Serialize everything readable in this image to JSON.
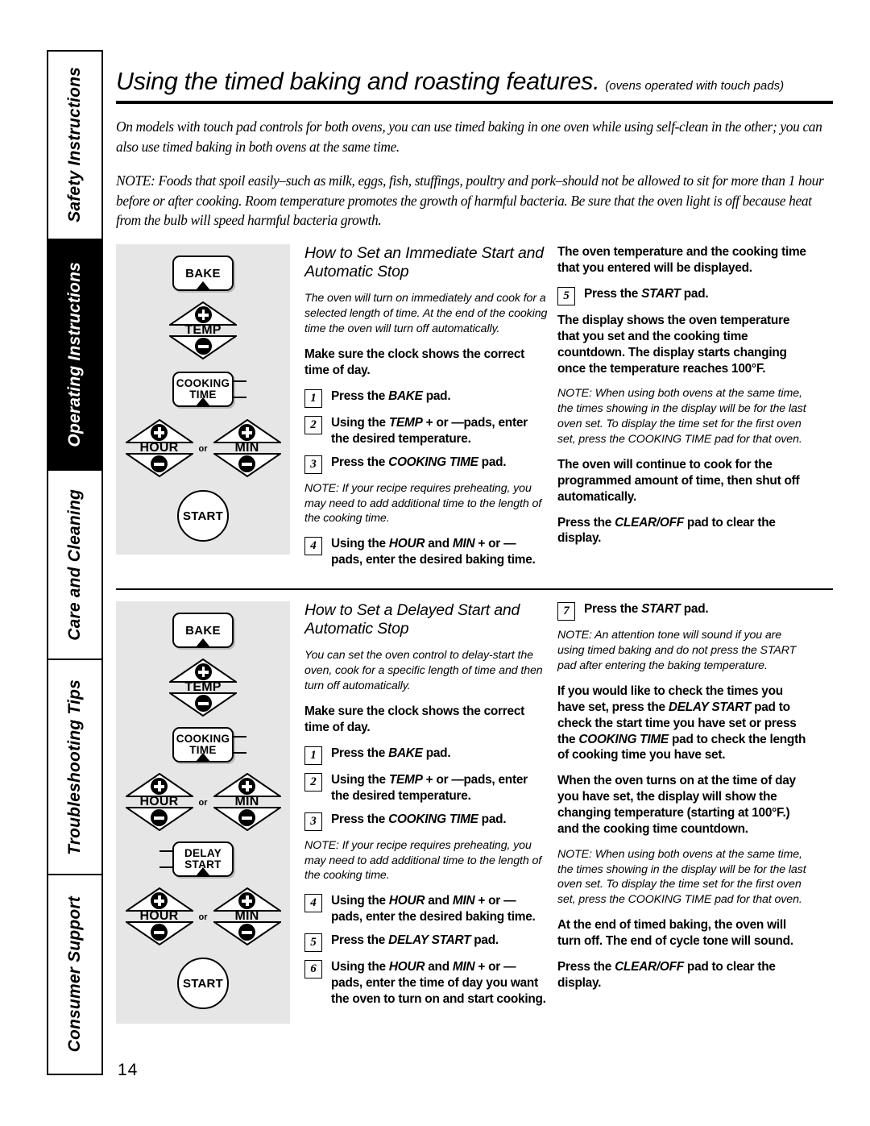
{
  "sidebar": {
    "tabs": [
      {
        "label": "Safety Instructions",
        "active": false
      },
      {
        "label": "Operating Instructions",
        "active": true
      },
      {
        "label": "Care and Cleaning",
        "active": false
      },
      {
        "label": "Troubleshooting Tips",
        "active": false
      },
      {
        "label": "Consumer Support",
        "active": false
      }
    ]
  },
  "header": {
    "title": "Using the timed baking and roasting features.",
    "subtitle": "(ovens operated with touch pads)"
  },
  "intro": {
    "paragraph1": "On models with touch pad controls for both ovens, you can use timed baking in one oven while using self-clean in the other; you can also use timed baking in both ovens at the same time.",
    "paragraph2": "NOTE: Foods that spoil easily–such as milk, eggs, fish, stuffings, poultry and pork–should not be allowed to sit for more than 1 hour before or after cooking. Room temperature promotes the growth of harmful bacteria. Be sure that the oven light is off because heat from the bulb will speed harmful bacteria growth."
  },
  "section1": {
    "heading": "How to Set an Immediate Start and Automatic Stop",
    "lead": "The oven will turn on immediately and cook for a selected length of time. At the end of the cooking time the oven will turn off automatically.",
    "bold_intro": "Make sure the clock shows the correct time of day.",
    "steps": [
      {
        "num": "1",
        "text": "Press the BAKE pad."
      },
      {
        "num": "2",
        "text": "Using the TEMP + or —pads, enter the desired temperature."
      },
      {
        "num": "3",
        "text": "Press the COOKING TIME pad."
      },
      {
        "num": "4",
        "text": "Using the HOUR and MIN + or — pads, enter the desired baking time."
      },
      {
        "num": "5",
        "text": "Press the START pad."
      }
    ],
    "note1": "NOTE: If your recipe requires preheating, you may need to add additional time to the length of the cooking time.",
    "right_bold1": "The oven temperature and the cooking time that you entered will be displayed.",
    "right_bold2": "The display shows the oven temperature that you set and the cooking time countdown. The display starts changing once the temperature reaches 100°F.",
    "right_note": "NOTE: When using both ovens at the same time, the times showing in the display will be for the last oven set. To display the time set for the first oven set, press the COOKING TIME pad for that oven.",
    "right_bold3": "The oven will continue to cook for the programmed amount of time, then shut off automatically.",
    "right_bold4": "Press the CLEAR/OFF pad to clear the display.",
    "panel": {
      "pads": [
        "BAKE",
        "TEMP",
        "COOKING TIME",
        "HOUR",
        "MIN",
        "START"
      ],
      "or_label": "or"
    }
  },
  "section2": {
    "heading": "How to Set a Delayed Start and Automatic Stop",
    "lead": "You can set the oven control to delay-start the oven, cook for a specific length of time and then turn off automatically.",
    "bold_intro": "Make sure the clock shows the correct time of day.",
    "steps": [
      {
        "num": "1",
        "text": "Press the BAKE pad."
      },
      {
        "num": "2",
        "text": "Using the TEMP + or —pads, enter the desired temperature."
      },
      {
        "num": "3",
        "text": "Press the COOKING TIME pad."
      },
      {
        "num": "4",
        "text": "Using the HOUR and MIN + or — pads, enter the desired baking time."
      },
      {
        "num": "5",
        "text": "Press the DELAY START pad."
      },
      {
        "num": "6",
        "text": "Using the HOUR and MIN + or — pads, enter the time of day you want the oven to turn on and start cooking."
      },
      {
        "num": "7",
        "text": "Press the START pad."
      }
    ],
    "note1": "NOTE: If your recipe requires preheating, you may need to add additional time to the length of the cooking time.",
    "right_note1": "NOTE: An attention tone will sound if you are using timed baking and do not press the START pad after entering the baking temperature.",
    "right_bold1": "If you would like to check the times you have set, press the DELAY START pad to check the start time you have set or press the COOKING TIME pad to check the length of cooking time you have set.",
    "right_bold2": "When the oven turns on at the time of day you have set, the display will show the changing temperature (starting at 100°F.) and the cooking time countdown.",
    "right_note2": "NOTE: When using both ovens at the same time, the times showing in the display will be for the last oven set. To display the time set for the first oven set, press the COOKING TIME pad for that oven.",
    "right_bold3": "At the end of timed baking, the oven will turn off. The end of cycle tone will sound.",
    "right_bold4": "Press the CLEAR/OFF pad to clear the display.",
    "panel": {
      "pads": [
        "BAKE",
        "TEMP",
        "COOKING TIME",
        "HOUR",
        "MIN",
        "DELAY START",
        "HOUR",
        "MIN",
        "START"
      ],
      "or_label": "or"
    }
  },
  "footer": {
    "page_number": "14"
  },
  "colors": {
    "panel_background": "#e6e6e6",
    "ink": "#000000",
    "page": "#ffffff"
  }
}
